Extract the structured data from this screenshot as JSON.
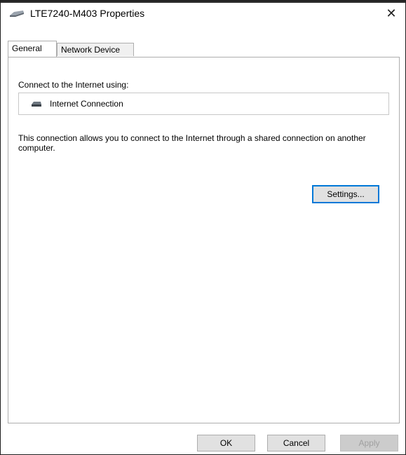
{
  "window": {
    "title": "LTE7240-M403 Properties",
    "title_icon": "network-adapter-icon",
    "close_glyph": "✕"
  },
  "tabs": [
    {
      "label": "General",
      "active": true
    },
    {
      "label": "Network Device",
      "active": false
    }
  ],
  "general": {
    "connect_label": "Connect to the Internet using:",
    "connection": {
      "icon": "network-adapter-icon",
      "name": "Internet Connection"
    },
    "description": "This connection allows you to connect to the Internet through a shared connection on another computer.",
    "settings_label": "Settings..."
  },
  "footer": {
    "ok_label": "OK",
    "cancel_label": "Cancel",
    "apply_label": "Apply",
    "apply_enabled": false
  },
  "colors": {
    "focus_border": "#0078d7",
    "button_face": "#e1e1e1",
    "disabled_text": "#a0a0a0"
  }
}
